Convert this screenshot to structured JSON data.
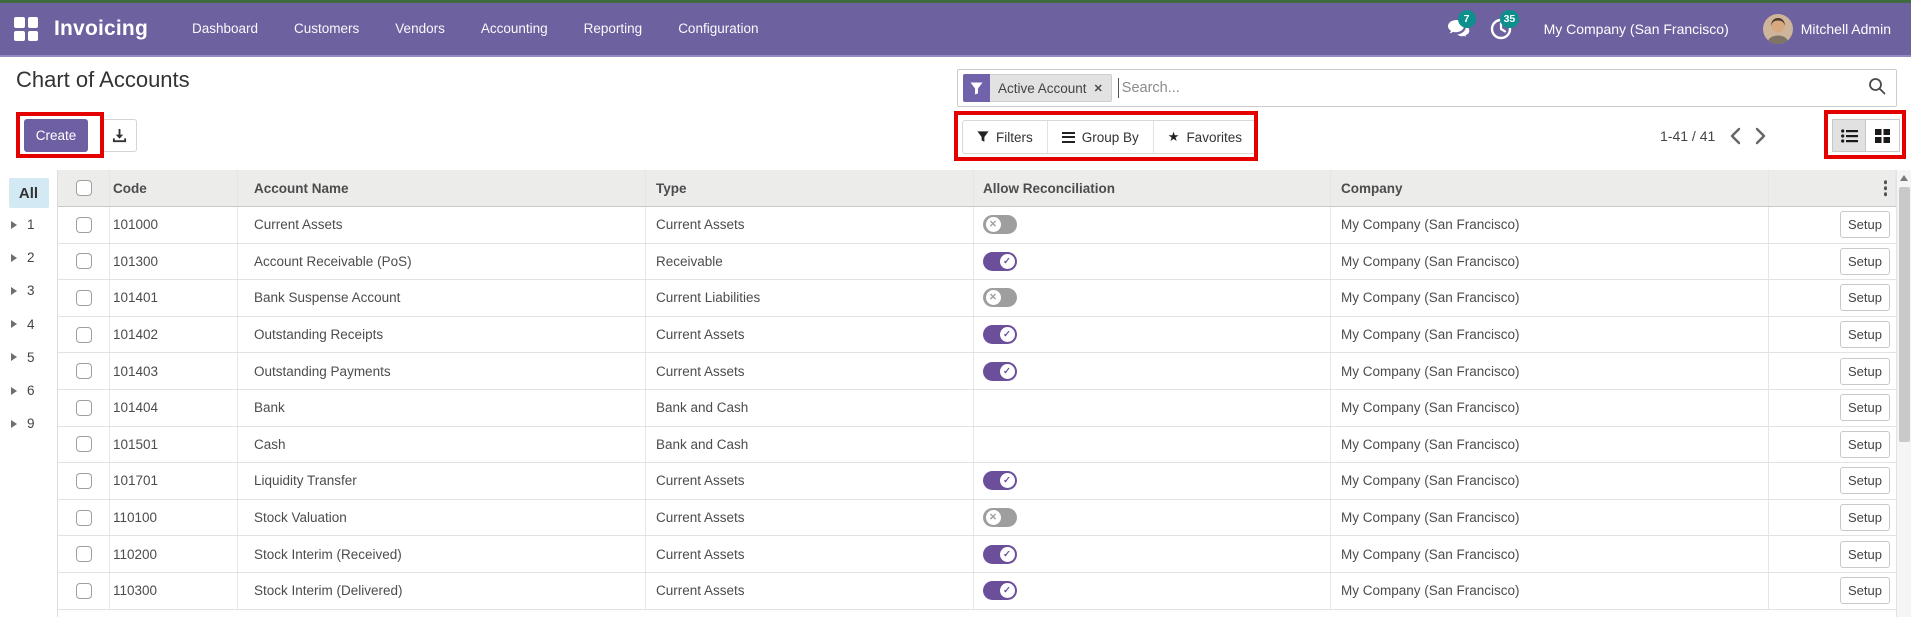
{
  "nav": {
    "brand": "Invoicing",
    "items": [
      "Dashboard",
      "Customers",
      "Vendors",
      "Accounting",
      "Reporting",
      "Configuration"
    ],
    "messages_count": "7",
    "activities_count": "35",
    "company": "My Company (San Francisco)",
    "user": "Mitchell Admin"
  },
  "page": {
    "title": "Chart of Accounts",
    "create_label": "Create",
    "search": {
      "facet": "Active Account",
      "placeholder": "Search..."
    },
    "filters_label": "Filters",
    "group_by_label": "Group By",
    "favorites_label": "Favorites",
    "pager": {
      "text": "1-41 / 41"
    }
  },
  "sidebar": {
    "all_label": "All",
    "groups": [
      "1",
      "2",
      "3",
      "4",
      "5",
      "6",
      "9"
    ]
  },
  "table": {
    "columns": [
      "Code",
      "Account Name",
      "Type",
      "Allow Reconciliation",
      "Company"
    ],
    "setup_label": "Setup",
    "rows": [
      {
        "code": "101000",
        "name": "Current Assets",
        "type": "Current Assets",
        "reconcile": "off",
        "company": "My Company (San Francisco)"
      },
      {
        "code": "101300",
        "name": "Account Receivable (PoS)",
        "type": "Receivable",
        "reconcile": "on",
        "company": "My Company (San Francisco)"
      },
      {
        "code": "101401",
        "name": "Bank Suspense Account",
        "type": "Current Liabilities",
        "reconcile": "off",
        "company": "My Company (San Francisco)"
      },
      {
        "code": "101402",
        "name": "Outstanding Receipts",
        "type": "Current Assets",
        "reconcile": "on",
        "company": "My Company (San Francisco)"
      },
      {
        "code": "101403",
        "name": "Outstanding Payments",
        "type": "Current Assets",
        "reconcile": "on",
        "company": "My Company (San Francisco)"
      },
      {
        "code": "101404",
        "name": "Bank",
        "type": "Bank and Cash",
        "reconcile": "none",
        "company": "My Company (San Francisco)"
      },
      {
        "code": "101501",
        "name": "Cash",
        "type": "Bank and Cash",
        "reconcile": "none",
        "company": "My Company (San Francisco)"
      },
      {
        "code": "101701",
        "name": "Liquidity Transfer",
        "type": "Current Assets",
        "reconcile": "on",
        "company": "My Company (San Francisco)"
      },
      {
        "code": "110100",
        "name": "Stock Valuation",
        "type": "Current Assets",
        "reconcile": "off",
        "company": "My Company (San Francisco)"
      },
      {
        "code": "110200",
        "name": "Stock Interim (Received)",
        "type": "Current Assets",
        "reconcile": "on",
        "company": "My Company (San Francisco)"
      },
      {
        "code": "110300",
        "name": "Stock Interim (Delivered)",
        "type": "Current Assets",
        "reconcile": "on",
        "company": "My Company (San Francisco)"
      }
    ]
  },
  "colors": {
    "navbar_bg": "#6d619f",
    "top_strip": "#3f6b41",
    "accent": "#6e5fa3",
    "badge": "#0d8f8b",
    "annotation": "#e50000",
    "toggle_on": "#6b4f9b",
    "toggle_off": "#9e9e9e",
    "sidebar_active_bg": "#d3e9f3"
  }
}
